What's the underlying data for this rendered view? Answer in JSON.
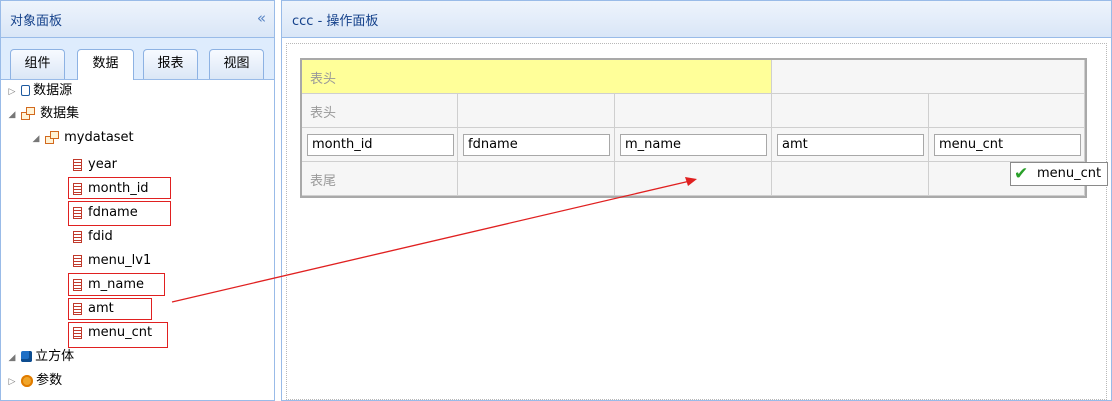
{
  "left_panel": {
    "title": "对象面板",
    "collapse_icon": "«",
    "tabs": [
      {
        "label": "组件",
        "active": false
      },
      {
        "label": "数据",
        "active": true
      },
      {
        "label": "报表",
        "active": false
      },
      {
        "label": "视图",
        "active": false
      }
    ],
    "tree": {
      "datasource": "数据源",
      "dataset_root": "数据集",
      "dataset": "mydataset",
      "fields": [
        "year",
        "month_id",
        "fdname",
        "fdid",
        "menu_lv1",
        "m_name",
        "amt",
        "menu_cnt"
      ],
      "cube": "立方体",
      "param": "参数"
    }
  },
  "right_panel": {
    "title": "ccc - 操作面板",
    "grid": {
      "header_label": "表头",
      "header_label_2": "表头",
      "footer_label": "表尾",
      "fields": [
        "month_id",
        "fdname",
        "m_name",
        "amt",
        "menu_cnt"
      ]
    },
    "drag_tooltip": "menu_cnt"
  },
  "colors": {
    "accent": "#15428b",
    "highlight_row": "#ffff99",
    "annotation": "#e02020",
    "check": "#2aa02a"
  }
}
